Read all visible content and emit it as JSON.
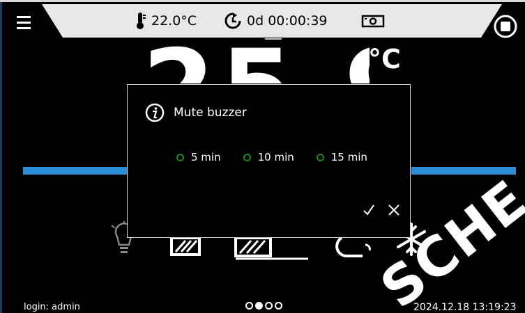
{
  "status_bar": {
    "temperature": "22.0°C",
    "timer": "0d 00:00:39",
    "thermometer_icon": "thermometer-icon",
    "timer_icon": "clock-timer-icon",
    "camera_icon": "camera-icon"
  },
  "main": {
    "big_temperature": "25.9",
    "unit": "°C"
  },
  "dialog": {
    "title": "Mute buzzer",
    "options": [
      {
        "label": "5 min"
      },
      {
        "label": "10 min"
      },
      {
        "label": "15 min"
      }
    ],
    "confirm_icon": "check-icon",
    "cancel_icon": "close-icon"
  },
  "footer": {
    "login": "login: admin",
    "datetime": "2024.12.18  13:19:23",
    "page_count": 4,
    "active_page": 2
  },
  "watermark": "SCHE",
  "colors": {
    "accent_blue": "#2a8fd6",
    "radio_green": "#1f8a1f",
    "status_bar": "#e8e8e8"
  }
}
